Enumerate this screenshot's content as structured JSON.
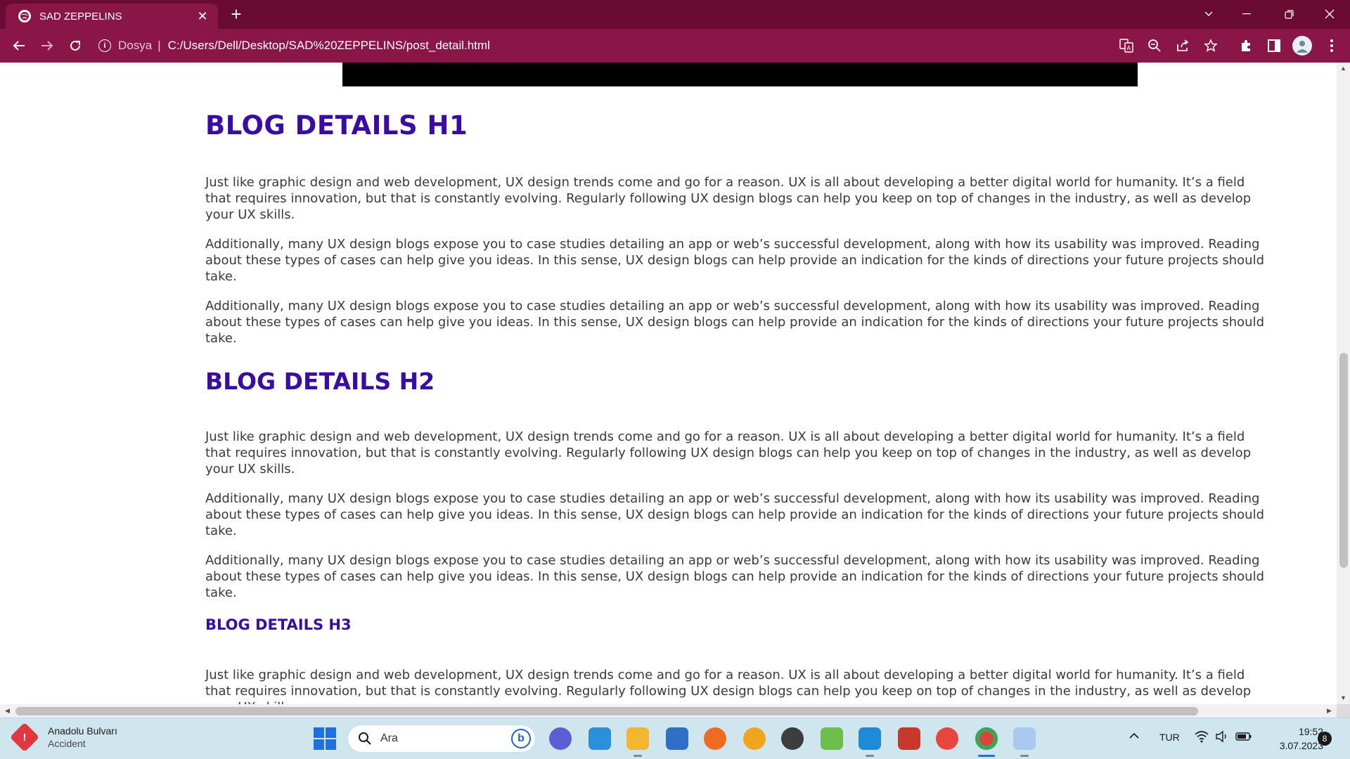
{
  "browser": {
    "tab_title": "SAD ZEPPELINS",
    "tab_close": "✕",
    "new_tab": "+",
    "address_scheme": "Dosya",
    "address_separator": "|",
    "address_url": "C:/Users/Dell/Desktop/SAD%20ZEPPELINS/post_detail.html",
    "colors": {
      "tabstrip": "#6a0c32",
      "toolbar": "#8a1647"
    }
  },
  "article": {
    "h1": "BLOG DETAILS H1",
    "h2": "BLOG DETAILS H2",
    "h3": "BLOG DETAILS H3",
    "p_intro": "Just like graphic design and web development, UX design trends come and go for a reason. UX is all about developing a better digital world for humanity. It’s a field that requires innovation, but that is constantly evolving. Regularly following UX design blogs can help you keep on top of changes in the industry, as well as develop your UX skills.",
    "p_additional": "Additionally, many UX design blogs expose you to case studies detailing an app or web’s successful development, along with how its usability was improved. Reading about these types of cases can help give you ideas. In this sense, UX design blogs can help provide an indication for the kinds of directions your future projects should take.",
    "heading_color": "#3a0ca3"
  },
  "taskbar": {
    "weather_title": "Anadolu Bulvarı",
    "weather_subtitle": "Accident",
    "weather_badge": "!",
    "search_label": "Ara",
    "bing": "b",
    "language": "TUR",
    "time": "19:52",
    "date": "3.07.2023",
    "notifications": "8"
  }
}
